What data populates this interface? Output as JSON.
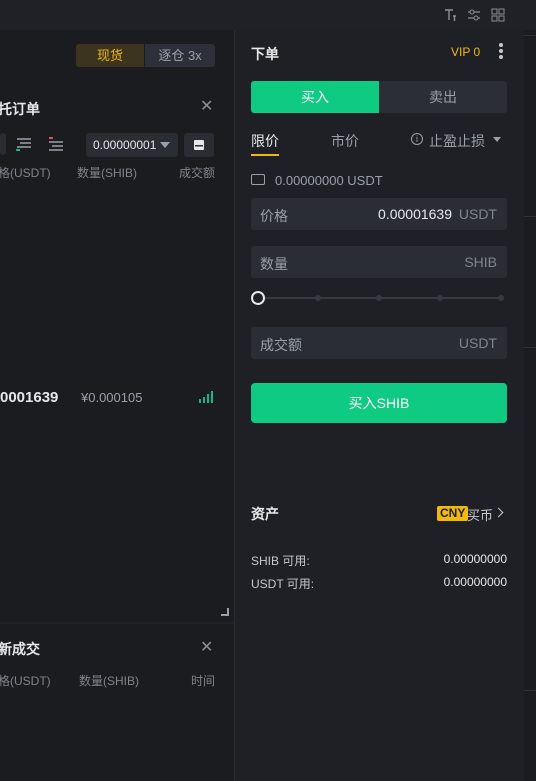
{
  "left": {
    "modes": {
      "spot": "现货",
      "cross": "逐仓 3x"
    },
    "orderbook": {
      "title": "托订单",
      "precision": "0.00000001",
      "headers": {
        "price": "格(USDT)",
        "amount": "数量(SHIB)",
        "total": "成交额"
      },
      "last_price": "0001639",
      "cny_price": "¥0.000105"
    },
    "trades": {
      "title": "新成交",
      "headers": {
        "price": "格(USDT)",
        "amount": "数量(SHIB)",
        "time": "时间"
      }
    }
  },
  "order": {
    "title": "下单",
    "vip": "VIP 0",
    "tabs": {
      "buy": "买入",
      "sell": "卖出"
    },
    "types": {
      "limit": "限价",
      "market": "市价",
      "stop": "止盈止损"
    },
    "balance": "0.00000000 USDT",
    "price": {
      "label": "价格",
      "value": "0.00001639",
      "unit": "USDT"
    },
    "amount": {
      "label": "数量",
      "value": "",
      "unit": "SHIB"
    },
    "total": {
      "label": "成交额",
      "value": "",
      "unit": "USDT"
    },
    "slider_percent": 0,
    "submit": "买入SHIB"
  },
  "assets": {
    "title": "资产",
    "currency": "CNY",
    "buy_coin": "买币",
    "rows": [
      {
        "name": "SHIB 可用:",
        "amount": "0.00000000"
      },
      {
        "name": "USDT 可用:",
        "amount": "0.00000000"
      }
    ]
  },
  "colors": {
    "buy": "#0ecb81",
    "accent": "#f0b90b",
    "background": "#1b1c20"
  }
}
